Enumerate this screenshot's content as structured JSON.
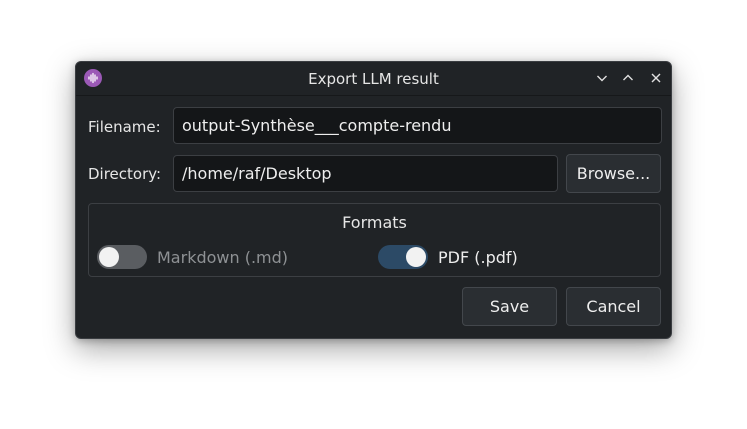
{
  "window": {
    "title": "Export LLM result",
    "app_icon": "waveform-icon",
    "controls": [
      "minimize",
      "maximize",
      "close"
    ]
  },
  "form": {
    "filename_label": "Filename:",
    "filename_value": "output-Synthèse___compte-rendu",
    "directory_label": "Directory:",
    "directory_value": "/home/raf/Desktop",
    "browse_label": "Browse..."
  },
  "formats": {
    "title": "Formats",
    "options": [
      {
        "label": "Markdown (.md)",
        "checked": false
      },
      {
        "label": "PDF (.pdf)",
        "checked": true
      }
    ]
  },
  "actions": {
    "save_label": "Save",
    "cancel_label": "Cancel"
  },
  "colors": {
    "accent": "#9b59b6",
    "toggle_on": "#2c4a66",
    "toggle_off": "#5a5d61",
    "window_bg": "#202326"
  }
}
